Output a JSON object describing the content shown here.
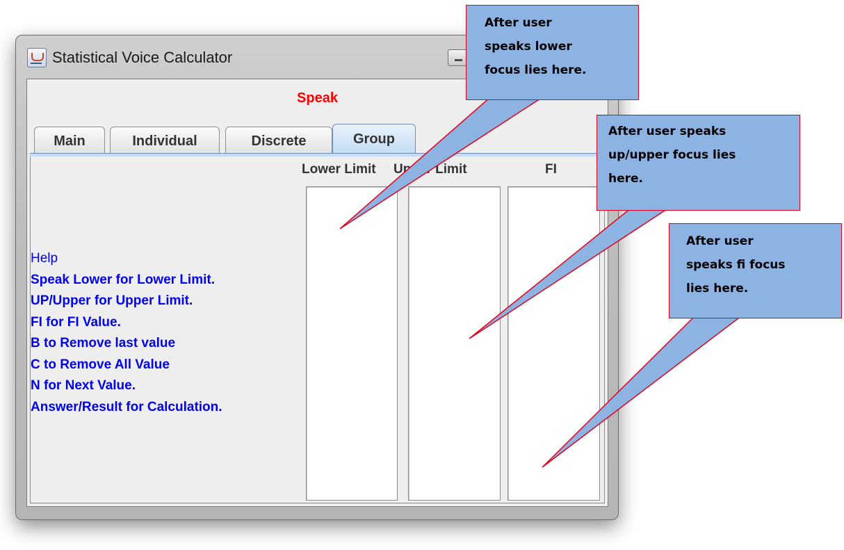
{
  "window": {
    "title": "Statistical Voice Calculator"
  },
  "speak_label": "Speak",
  "tabs": [
    {
      "label": "Main"
    },
    {
      "label": "Individual"
    },
    {
      "label": "Discrete"
    },
    {
      "label": "Group",
      "selected": true
    }
  ],
  "columns": {
    "lower": "Lower Limit",
    "upper": "Upper Limit",
    "fi": "FI"
  },
  "help": {
    "title": "Help",
    "lines": [
      "Speak Lower for Lower Limit.",
      "UP/Upper for Upper Limit.",
      "FI for FI Value.",
      "B to Remove last value",
      "C to Remove All Value",
      "N for Next Value.",
      "Answer/Result for Calculation."
    ]
  },
  "callouts": {
    "lower": [
      "After user",
      "speaks lower",
      "focus lies here."
    ],
    "upper": [
      "After user speaks",
      "up/upper focus lies",
      "here."
    ],
    "fi": [
      "After user",
      "speaks fi focus",
      "lies here."
    ]
  },
  "colors": {
    "speak": "#ff0000",
    "help_text": "#0000ee",
    "callout_fill": "#8db3e2",
    "callout_border": "#e3001b"
  }
}
